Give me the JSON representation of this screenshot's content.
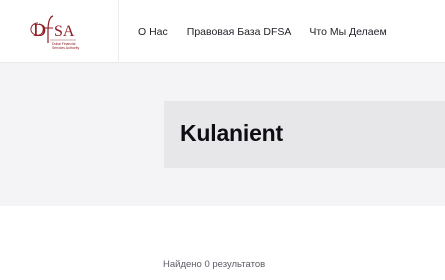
{
  "logo": {
    "mark": "DFSA",
    "subtitle_lines": [
      "Dubai Financial",
      "Services Authority"
    ],
    "color": "#8d1b24"
  },
  "nav": {
    "items": [
      {
        "label": "О Нас"
      },
      {
        "label": "Правовая База DFSA"
      },
      {
        "label": "Что Мы Делаем"
      }
    ]
  },
  "hero": {
    "title": "Kulanient"
  },
  "results": {
    "summary": "Найдено 0 результатов"
  },
  "colors": {
    "brand": "#8d1b24",
    "hero_bg": "#f4f4f6",
    "title_box_bg": "#e7e7ea",
    "text": "#0e0e12"
  }
}
